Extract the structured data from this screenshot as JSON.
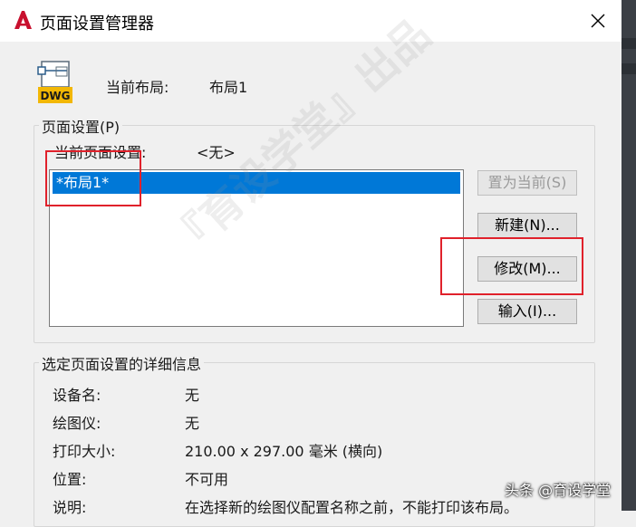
{
  "window": {
    "title": "页面设置管理器"
  },
  "current_layout": {
    "label": "当前布局:",
    "value": "布局1",
    "icon_text": "DWG"
  },
  "page_setup_group": {
    "legend": "页面设置(P)",
    "current_setup_label": "当前页面设置:",
    "current_setup_value": "<无>",
    "list_items": [
      "*布局1*"
    ]
  },
  "buttons": {
    "set_current": "置为当前(S)",
    "new": "新建(N)...",
    "modify": "修改(M)...",
    "import": "输入(I)..."
  },
  "details_group": {
    "legend": "选定页面设置的详细信息",
    "rows": [
      {
        "label": "设备名:",
        "value": "无"
      },
      {
        "label": "绘图仪:",
        "value": "无"
      },
      {
        "label": "打印大小:",
        "value": "210.00 x 297.00 毫米 (横向)"
      },
      {
        "label": "位置:",
        "value": "不可用"
      },
      {
        "label": "说明:",
        "value": "在选择新的绘图仪配置名称之前，不能打印该布局。"
      }
    ]
  },
  "overlay": {
    "watermark": "『育设学堂』出品",
    "source": "头条 @育设学堂"
  },
  "colors": {
    "selection": "#0078d7",
    "highlight_box": "#e0212b",
    "app_icon": "#c8102e"
  }
}
